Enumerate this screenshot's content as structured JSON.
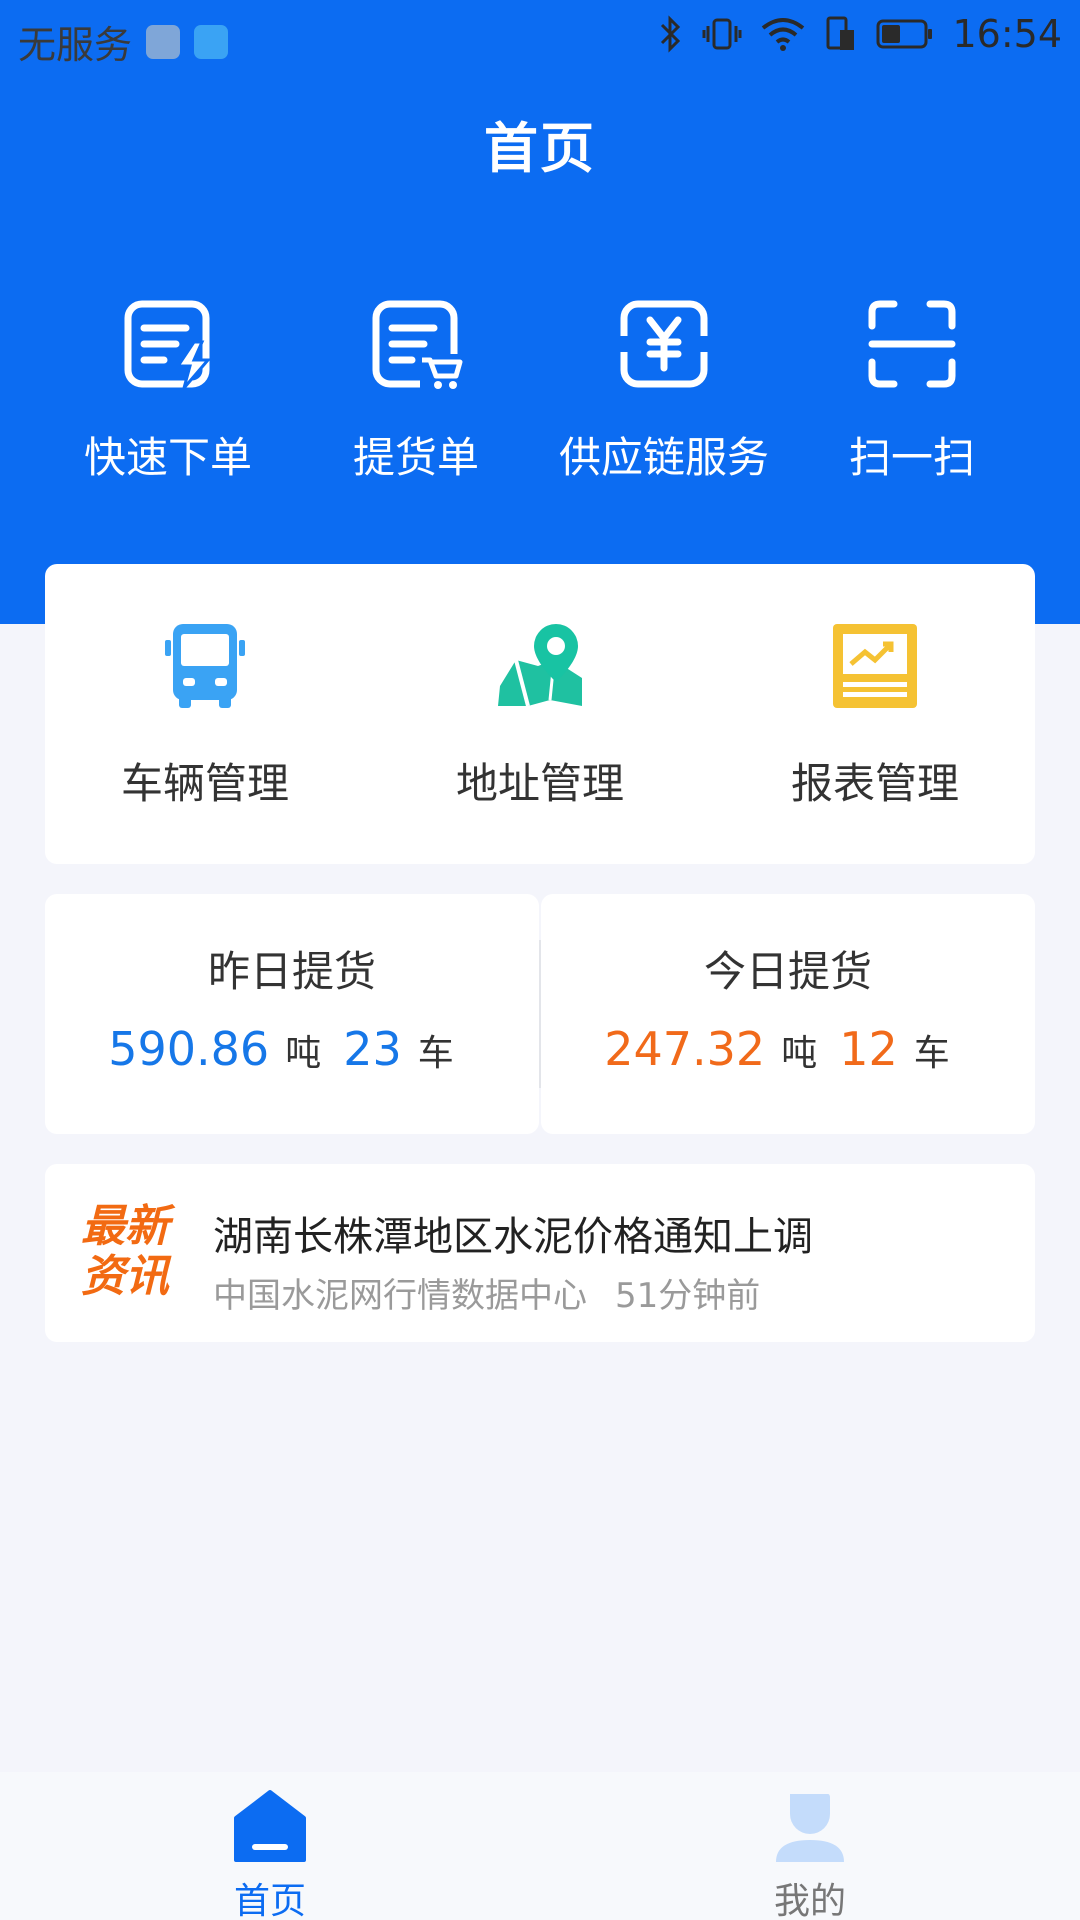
{
  "status_bar": {
    "carrier": "无服务",
    "time": "16:54"
  },
  "header": {
    "title": "首页"
  },
  "quick_actions": [
    {
      "label": "快速下单",
      "icon": "order-lightning-icon"
    },
    {
      "label": "提货单",
      "icon": "order-cart-icon"
    },
    {
      "label": "供应链服务",
      "icon": "yuan-icon"
    },
    {
      "label": "扫一扫",
      "icon": "scan-icon"
    }
  ],
  "management": [
    {
      "label": "车辆管理",
      "icon": "bus-icon"
    },
    {
      "label": "地址管理",
      "icon": "map-pin-icon"
    },
    {
      "label": "报表管理",
      "icon": "report-icon"
    }
  ],
  "stats": {
    "yesterday": {
      "title": "昨日提货",
      "tons": "590.86",
      "ton_unit": "吨",
      "cars": "23",
      "car_unit": "车"
    },
    "today": {
      "title": "今日提货",
      "tons": "247.32",
      "ton_unit": "吨",
      "cars": "12",
      "car_unit": "车"
    }
  },
  "news": {
    "badge_line1": "最新",
    "badge_line2": "资讯",
    "title": "湖南长株潭地区水泥价格通知上调",
    "source": "中国水泥网行情数据中心",
    "time": "51分钟前"
  },
  "tabbar": {
    "items": [
      {
        "label": "首页",
        "icon": "home-icon",
        "active": true
      },
      {
        "label": "我的",
        "icon": "user-icon",
        "active": false
      }
    ]
  },
  "colors": {
    "primary": "#0c6cf2",
    "yesterday_value": "#1677e8",
    "today_value": "#f16a1a",
    "news_badge": "#f26a12",
    "page_bg": "#f4f5fb"
  }
}
